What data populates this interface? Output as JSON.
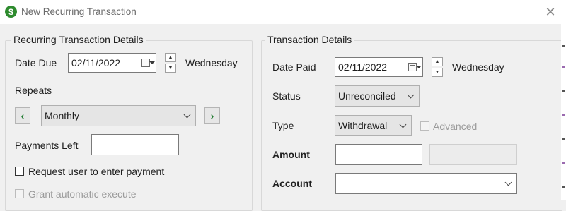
{
  "window": {
    "title": "New Recurring Transaction",
    "app_icon": "dollar-icon",
    "app_icon_glyph": "$",
    "close_glyph": "✕"
  },
  "recurring": {
    "group_title": "Recurring Transaction Details",
    "date_due_label": "Date Due",
    "date_due_value": "02/11/2022",
    "date_due_weekday": "Wednesday",
    "repeats_label": "Repeats",
    "prev_glyph": "‹",
    "next_glyph": "›",
    "repeats_value": "Monthly",
    "payments_left_label": "Payments Left",
    "payments_left_value": "",
    "request_user_label": "Request user to enter payment",
    "request_user_checked": false,
    "grant_auto_label": "Grant automatic execute",
    "grant_auto_checked": false
  },
  "transaction": {
    "group_title": "Transaction Details",
    "date_paid_label": "Date Paid",
    "date_paid_value": "02/11/2022",
    "date_paid_weekday": "Wednesday",
    "status_label": "Status",
    "status_value": "Unreconciled",
    "type_label": "Type",
    "type_value": "Withdrawal",
    "advanced_label": "Advanced",
    "advanced_checked": false,
    "amount_label": "Amount",
    "amount_value": "",
    "account_label": "Account",
    "account_value": ""
  },
  "colors": {
    "accent_green": "#2e8b2e",
    "nav_arrow_green": "#1e7a2e",
    "window_bg": "#f0f0f0"
  }
}
